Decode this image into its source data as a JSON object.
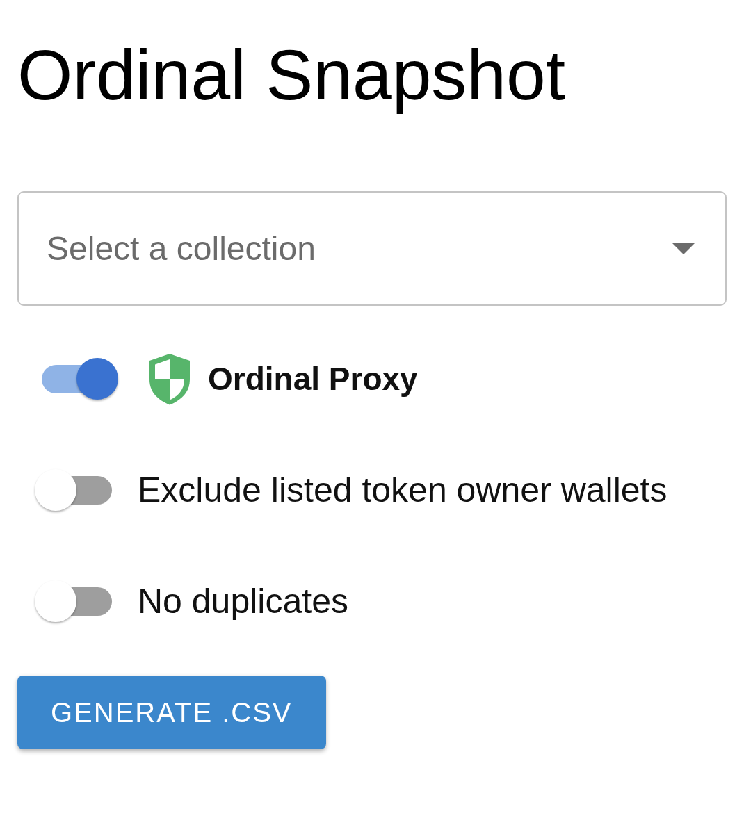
{
  "title": "Ordinal Snapshot",
  "collection_select": {
    "placeholder": "Select a collection"
  },
  "options": [
    {
      "kind": "badged",
      "label": "Ordinal Proxy",
      "on": true
    },
    {
      "kind": "plain",
      "label": "Exclude listed token owner wallets",
      "on": false
    },
    {
      "kind": "plain",
      "label": "No duplicates",
      "on": false
    }
  ],
  "generate_button": {
    "label": "GENERATE .CSV"
  }
}
